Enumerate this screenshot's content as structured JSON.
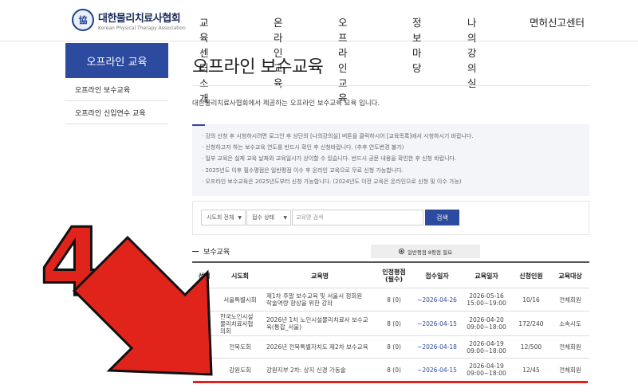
{
  "header": {
    "logo_ko": "대한물리치료사협회",
    "logo_en": "Korean Physical Therapy Association",
    "nav": [
      "교육센터 소개",
      "온라인 교육",
      "오프라인 교육",
      "정보마당",
      "나의강의실",
      "면허신고센터"
    ]
  },
  "sidebar": {
    "title": "오프라인 교육",
    "items": [
      "오프라인 보수교육",
      "오프라인 신입연수 교육"
    ]
  },
  "main": {
    "title": "오프라인 보수교육",
    "intro": "대한물리치료사협회에서 제공하는 오프라인 보수교육 교육 입니다.",
    "notices": [
      "· 강의 신청 후 시청하시려면 로그인 후 상단의 [나의강의실] 버튼을 클릭하시어 [교육목록]에서 시청하시기 바랍니다.",
      "· 신청하고자 하는 보수교육 연도를 반드시 확인 후 신청바랍니다. (추후 연도변경 불가)",
      "· 일부 교육은 실제 교육 날짜와 교육일시가 상이할 수 있습니다. 반드시 공문 내용을 확인한 후 신청 바랍니다.",
      "· 2025년도 이후 필수평점은 일반평점 이수 후 온라인 교육으로 무료 신청 가능합니다.",
      "· 오프라인 보수교육은 2025년도부터 신청 가능합니다. (2024년도 이전 교육은 온라인으로 신청 및 이수 가능)"
    ],
    "search": {
      "region_select": "시도회 전체",
      "status_select": "접수 상태",
      "placeholder": "교육명 검색",
      "button": "검색"
    },
    "section_title": "보수교육",
    "legend": "일반평점 8평점 필요"
  },
  "table": {
    "headers": [
      "선택",
      "시도회",
      "교육명",
      "인정평점\n(필수)",
      "접수일자",
      "교육일자",
      "신청인원",
      "교육대상"
    ],
    "rows": [
      {
        "region": "서울특별시회",
        "name": "제1차 주말 보수교육 및 서울시 정회원\n학술역량 향상을 위한 강좌",
        "score": "8 (0)",
        "reg": "~2026-04-26",
        "date": "2026-05-16\n15:00~19:00",
        "count": "10/16",
        "target": "전체회원"
      },
      {
        "region": "한국노인시설\n물리치료사협\n의회",
        "name": "2026년 1차 노인시설물리치료사 보수교\n육(통합_서울)",
        "score": "8 (0)",
        "reg": "~2026-04-15",
        "date": "2026-04-20\n09:00~18:00",
        "count": "172/240",
        "target": "소속시도"
      },
      {
        "region": "전북도회",
        "name": "2026년 전북특별자치도 제2차 보수교육",
        "score": "8 (0)",
        "reg": "~2026-04-18",
        "date": "2026-04-19\n09:00~18:00",
        "count": "12/500",
        "target": "전체회원"
      },
      {
        "region": "강원도회",
        "name": "강원지부 2차: 상지 신경 가동술",
        "score": "8 (0)",
        "reg": "~2026-04-15",
        "date": "2026-04-19\n09:00~18:00",
        "count": "12/45",
        "target": "전체회원"
      }
    ]
  },
  "annotation": {
    "number": "4",
    "color": "#e0241c"
  }
}
